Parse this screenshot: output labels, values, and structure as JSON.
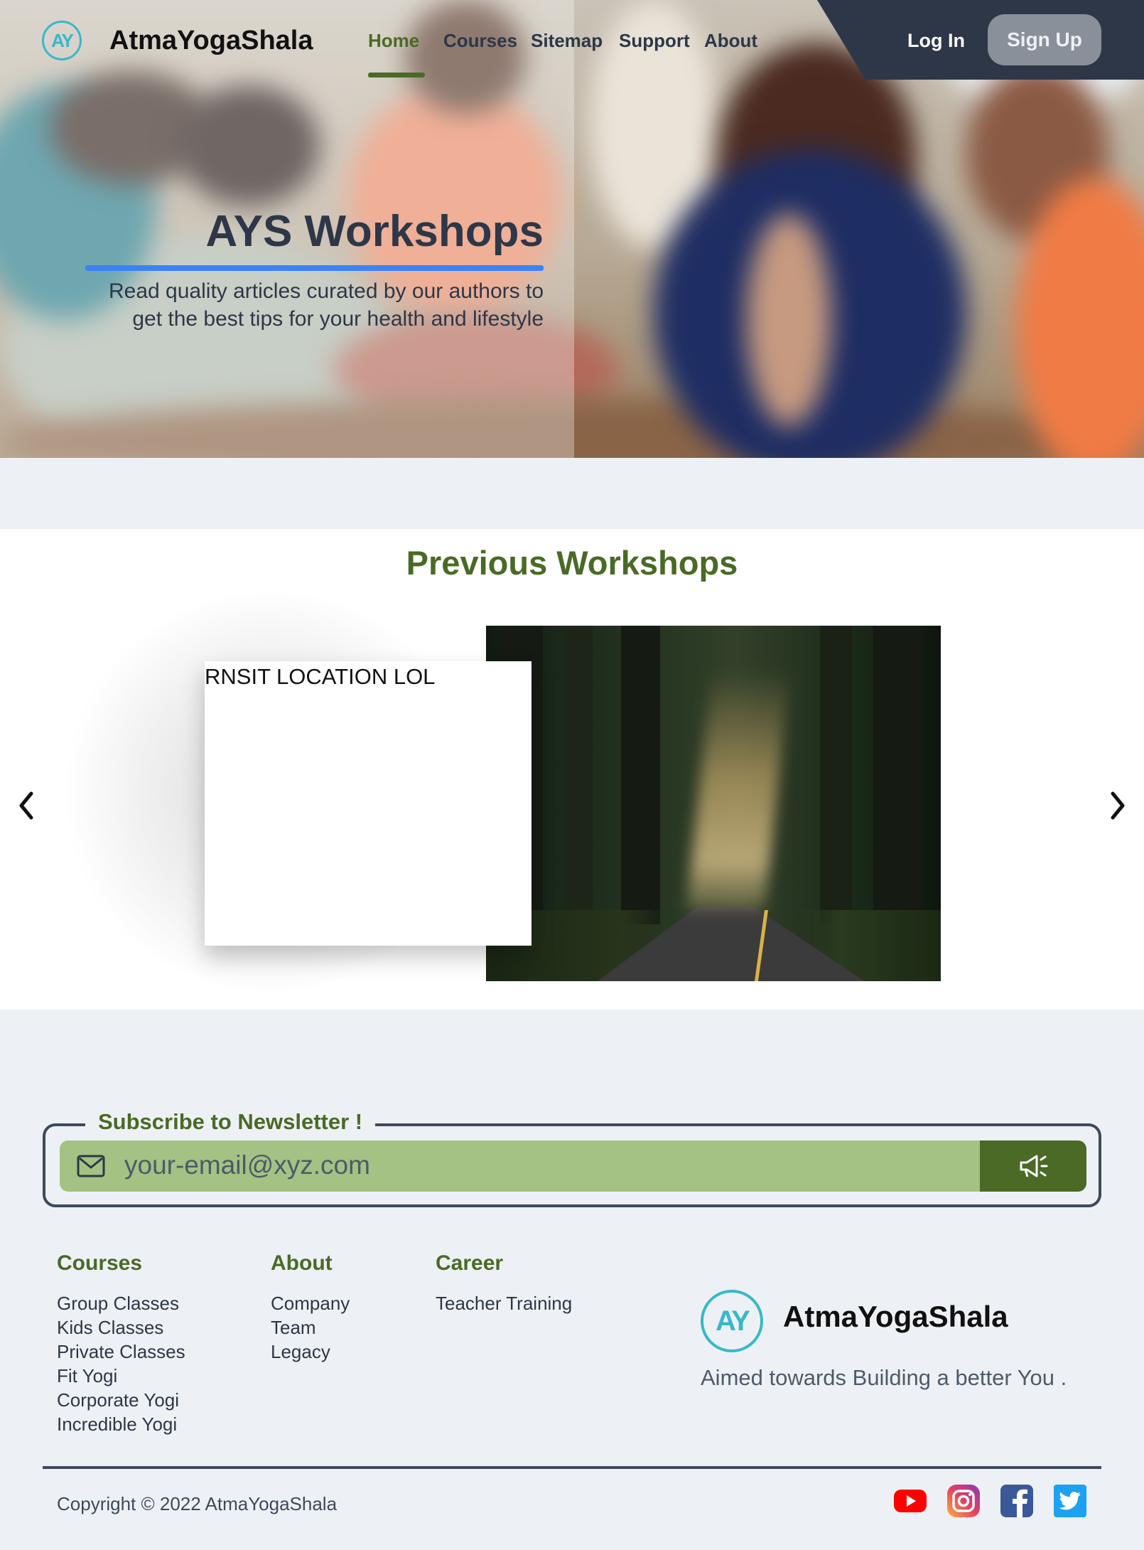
{
  "nav": {
    "logo_text": "AY",
    "brand": "AtmaYogaShala",
    "links": [
      "Home",
      "Courses",
      "Sitemap",
      "Support",
      "About"
    ],
    "active": "Home",
    "login": "Log In",
    "signup": "Sign Up"
  },
  "hero": {
    "title": "AYS Workshops",
    "subtitle_line1": "Read quality articles curated by our authors to",
    "subtitle_line2": "get the best tips for your health and lifestyle"
  },
  "workshops": {
    "title": "Previous Workshops",
    "card_text": "RNSIT LOCATION LOL"
  },
  "newsletter": {
    "legend": "Subscribe to Newsletter !",
    "placeholder": "your-email@xyz.com"
  },
  "footer": {
    "courses": {
      "heading": "Courses",
      "items": [
        "Group Classes",
        "Kids Classes",
        "Private Classes",
        "Fit Yogi",
        "Corporate Yogi",
        "Incredible Yogi"
      ]
    },
    "about": {
      "heading": "About",
      "items": [
        "Company",
        "Team",
        "Legacy"
      ]
    },
    "career": {
      "heading": "Career",
      "items": [
        "Teacher Training"
      ]
    },
    "brand": "AtmaYogaShala",
    "tagline": "Aimed towards Building a better You .",
    "copyright": "Copyright © 2022 AtmaYogaShala",
    "social_icons": [
      "youtube-icon",
      "instagram-icon",
      "facebook-icon",
      "twitter-icon"
    ]
  },
  "colors": {
    "primary_green": "#4a6a25",
    "dark_slate": "#2d3748",
    "accent_blue": "#3b82f6",
    "input_green": "#a4c283",
    "logo_teal": "#38b8c8"
  }
}
